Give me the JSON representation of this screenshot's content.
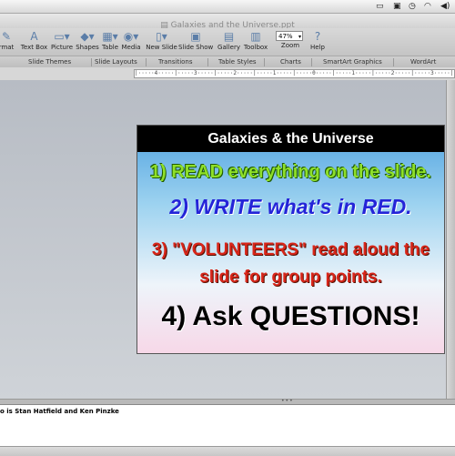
{
  "menubar": {
    "icons": [
      "monitor-icon",
      "display-icon",
      "clock-icon",
      "wifi-icon",
      "volume-icon"
    ]
  },
  "window": {
    "title": "Galaxies and the Universe.ppt"
  },
  "toolbar": {
    "format_label": "rmat",
    "text_box_label": "Text Box",
    "picture_label": "Picture",
    "shapes_label": "Shapes",
    "table_label": "Table",
    "media_label": "Media",
    "new_slide_label": "New Slide",
    "slide_show_label": "Slide Show",
    "gallery_label": "Gallery",
    "toolbox_label": "Toolbox",
    "zoom_label": "Zoom",
    "zoom_value": "47%",
    "help_label": "Help"
  },
  "ribbon": {
    "tabs": [
      "Slide Themes",
      "Slide Layouts",
      "Transitions",
      "Table Styles",
      "Charts",
      "SmartArt Graphics",
      "WordArt"
    ]
  },
  "ruler": {
    "text": "|·····4·····|·····3·····|·····2·····|·····1·····|·····0·····|·····1·····|·····2·····|·····3·····|·····4··"
  },
  "slide": {
    "title": "Galaxies & the Universe",
    "line1": "1) READ everything on the slide.",
    "line2": "2) WRITE what's in RED.",
    "line3a": "3) \"VOLUNTEERS\" read aloud the",
    "line3b": "slide for group points.",
    "line4": "4) Ask QUESTIONS!"
  },
  "notes": {
    "text": "o is Stan Hatfield and Ken Pinzke"
  }
}
